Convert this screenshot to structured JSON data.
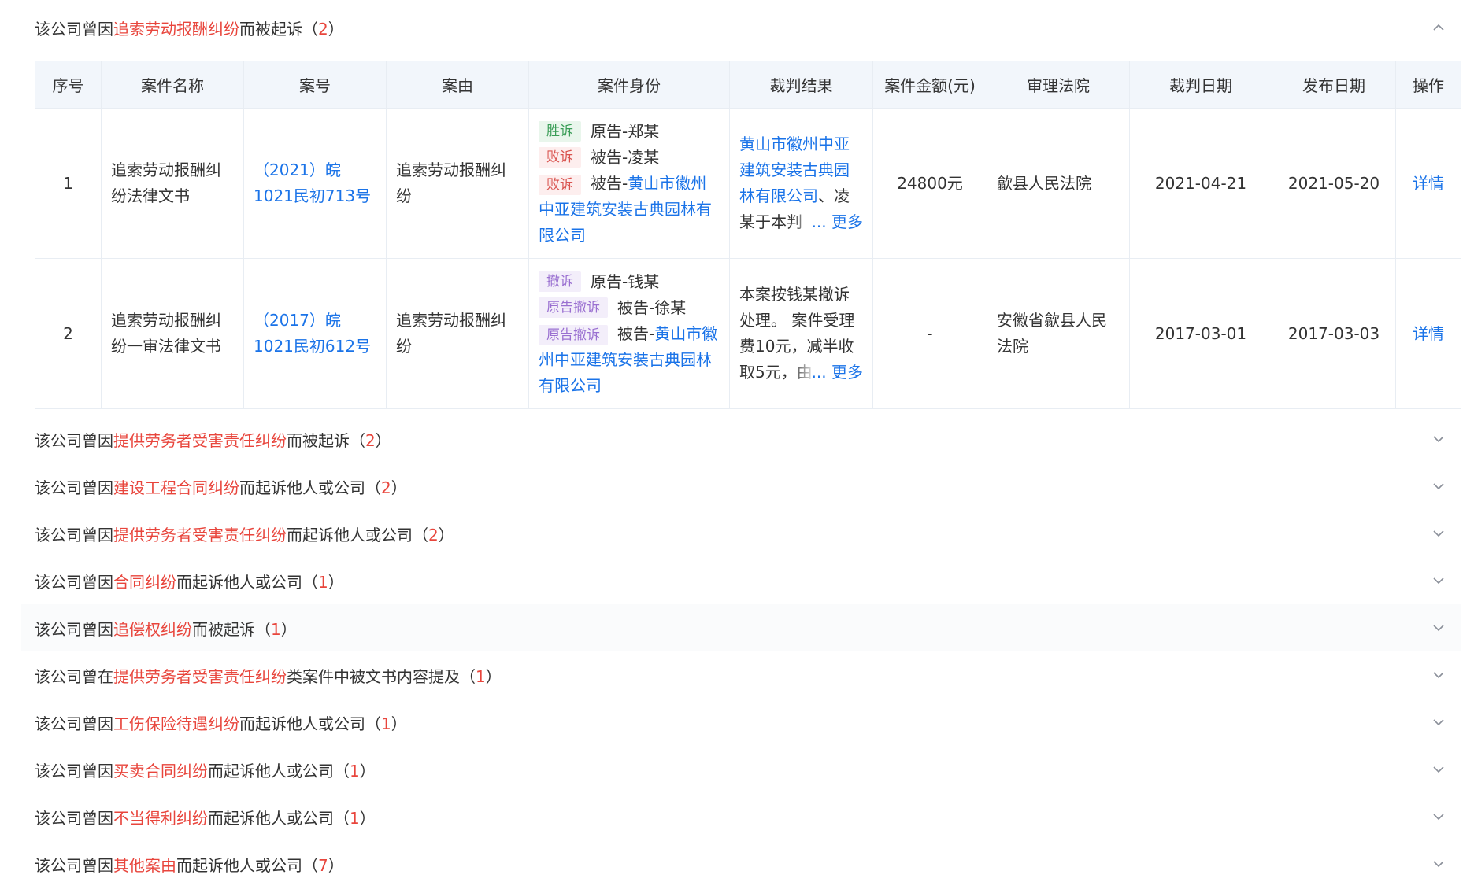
{
  "colors": {
    "accent_red": "#e8453c",
    "link_blue": "#1a73e8",
    "header_bg": "#f2f6fb",
    "border": "#e8edf3"
  },
  "sections": [
    {
      "prefix": "该公司曾因",
      "highlight": "追索劳动报酬纠纷",
      "suffix": "而被起诉（",
      "count": "2",
      "close": "）",
      "expanded": true,
      "icon": "chevron-up-icon"
    },
    {
      "prefix": "该公司曾因",
      "highlight": "提供劳务者受害责任纠纷",
      "suffix": "而被起诉（",
      "count": "2",
      "close": "）",
      "expanded": false,
      "icon": "chevron-down-icon"
    },
    {
      "prefix": "该公司曾因",
      "highlight": "建设工程合同纠纷",
      "suffix": "而起诉他人或公司（",
      "count": "2",
      "close": "）",
      "expanded": false,
      "icon": "chevron-down-icon"
    },
    {
      "prefix": "该公司曾因",
      "highlight": "提供劳务者受害责任纠纷",
      "suffix": "而起诉他人或公司（",
      "count": "2",
      "close": "）",
      "expanded": false,
      "icon": "chevron-down-icon"
    },
    {
      "prefix": "该公司曾因",
      "highlight": "合同纠纷",
      "suffix": "而起诉他人或公司（",
      "count": "1",
      "close": "）",
      "expanded": false,
      "icon": "chevron-down-icon"
    },
    {
      "prefix": "该公司曾因",
      "highlight": "追偿权纠纷",
      "suffix": "而被起诉（",
      "count": "1",
      "close": "）",
      "expanded": false,
      "icon": "chevron-down-icon"
    },
    {
      "prefix": "该公司曾在",
      "highlight": "提供劳务者受害责任纠纷",
      "suffix": "类案件中被文书内容提及（",
      "count": "1",
      "close": "）",
      "expanded": false,
      "icon": "chevron-down-icon"
    },
    {
      "prefix": "该公司曾因",
      "highlight": "工伤保险待遇纠纷",
      "suffix": "而起诉他人或公司（",
      "count": "1",
      "close": "）",
      "expanded": false,
      "icon": "chevron-down-icon"
    },
    {
      "prefix": "该公司曾因",
      "highlight": "买卖合同纠纷",
      "suffix": "而起诉他人或公司（",
      "count": "1",
      "close": "）",
      "expanded": false,
      "icon": "chevron-down-icon"
    },
    {
      "prefix": "该公司曾因",
      "highlight": "不当得利纠纷",
      "suffix": "而起诉他人或公司（",
      "count": "1",
      "close": "）",
      "expanded": false,
      "icon": "chevron-down-icon"
    },
    {
      "prefix": "该公司曾因",
      "highlight": "其他案由",
      "suffix": "而起诉他人或公司（",
      "count": "7",
      "close": "）",
      "expanded": false,
      "icon": "chevron-down-icon"
    }
  ],
  "table": {
    "headers": [
      "序号",
      "案件名称",
      "案号",
      "案由",
      "案件身份",
      "裁判结果",
      "案件金额(元)",
      "审理法院",
      "裁判日期",
      "发布日期",
      "操作"
    ],
    "rows": [
      {
        "index": "1",
        "name": "追索劳动报酬纠纷法律文书",
        "case_no": "（2021）皖1021民初713号",
        "cause": "追索劳动报酬纠纷",
        "parties": [
          {
            "tag": "胜诉",
            "tag_type": "win",
            "role": "原告-",
            "name": "郑某",
            "name_link": false
          },
          {
            "tag": "败诉",
            "tag_type": "lose",
            "role": "被告-",
            "name": "凌某",
            "name_link": false
          },
          {
            "tag": "败诉",
            "tag_type": "lose",
            "role": "被告-",
            "name": "黄山市徽州中亚建筑安装古典园林有限公司",
            "name_link": true
          }
        ],
        "judgment_link": "黄山市徽州中亚建筑安装古典园林有限公司",
        "judgment_text": "、凌某于本判",
        "judgment_more": "... 更多",
        "amount": "24800元",
        "court": "歙县人民法院",
        "judge_date": "2021-04-21",
        "publish_date": "2021-05-20",
        "action": "详情"
      },
      {
        "index": "2",
        "name": "追索劳动报酬纠纷一审法律文书",
        "case_no": "（2017）皖1021民初612号",
        "cause": "追索劳动报酬纠纷",
        "parties": [
          {
            "tag": "撤诉",
            "tag_type": "withdraw",
            "role": "原告-",
            "name": "钱某",
            "name_link": false
          },
          {
            "tag": "原告撤诉",
            "tag_type": "withdraw",
            "role": "被告-",
            "name": "徐某",
            "name_link": false
          },
          {
            "tag": "原告撤诉",
            "tag_type": "withdraw",
            "role": "被告-",
            "name": "黄山市徽州中亚建筑安装古典园林有限公司",
            "name_link": true
          }
        ],
        "judgment_link": "",
        "judgment_text": "本案按钱某撤诉处理。 案件受理费10元，减半收取5元，由",
        "judgment_more": "... 更多",
        "amount": "-",
        "court": "安徽省歙县人民法院",
        "judge_date": "2017-03-01",
        "publish_date": "2017-03-03",
        "action": "详情"
      }
    ]
  }
}
